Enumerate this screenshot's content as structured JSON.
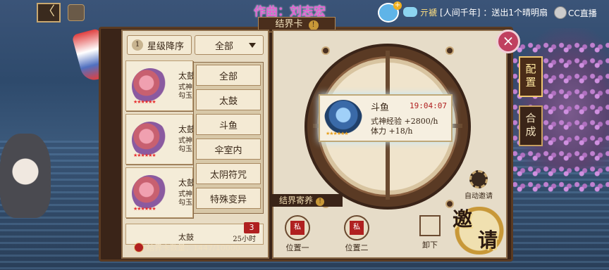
{
  "header": {
    "song_credit": "作曲：刘志宏",
    "plus_badge": "+",
    "ticker": {
      "user": "亓褫",
      "channel": "[人间千年]",
      "message": "：送出1个晴明扇"
    },
    "cc_logo_text": "CC直播"
  },
  "nav": {
    "back_icon": "left-arrow-icon",
    "back_symbol": "〈"
  },
  "panel": {
    "title": "结界卡",
    "title_info": "!"
  },
  "filters": {
    "sort_number": "1",
    "sort_label": "星级降序",
    "filter_value": "全部",
    "dropdown_options": [
      "全部",
      "太鼓",
      "斗鱼",
      "伞室内",
      "太阴符咒",
      "特殊变异"
    ]
  },
  "card_list": {
    "cards": [
      {
        "name": "太鼓",
        "line2": "式神",
        "line3": "勾玉",
        "stars": "★★★★★★"
      },
      {
        "name": "太鼓",
        "line2": "式神",
        "line3": "勾玉",
        "stars": "★★★★★★"
      },
      {
        "name": "太鼓",
        "line2": "式神",
        "line3": "勾玉",
        "stars": "★★★★★★"
      }
    ],
    "tail_card": {
      "name": "太鼓",
      "time": "25小时"
    },
    "badge_count": "3",
    "count_label": "结界卡数量：1447/10000"
  },
  "slot": {
    "name": "斗鱼",
    "timer": "19:04:07",
    "exp": "式神经验 +2800/h",
    "stamina": "体力 +18/h",
    "stars": "★★★★★★"
  },
  "auto_invite": "自动邀请",
  "foster": {
    "label": "结界寄养",
    "info": "!"
  },
  "positions": [
    {
      "seal": "私",
      "label": "位置一"
    },
    {
      "seal": "私",
      "label": "位置二"
    }
  ],
  "unload_label": "卸下",
  "invite": {
    "char1": "邀",
    "char2": "请"
  },
  "close_symbol": "×",
  "side_tabs": [
    {
      "label": "配置",
      "active": true
    },
    {
      "label": "合成",
      "active": false
    }
  ]
}
